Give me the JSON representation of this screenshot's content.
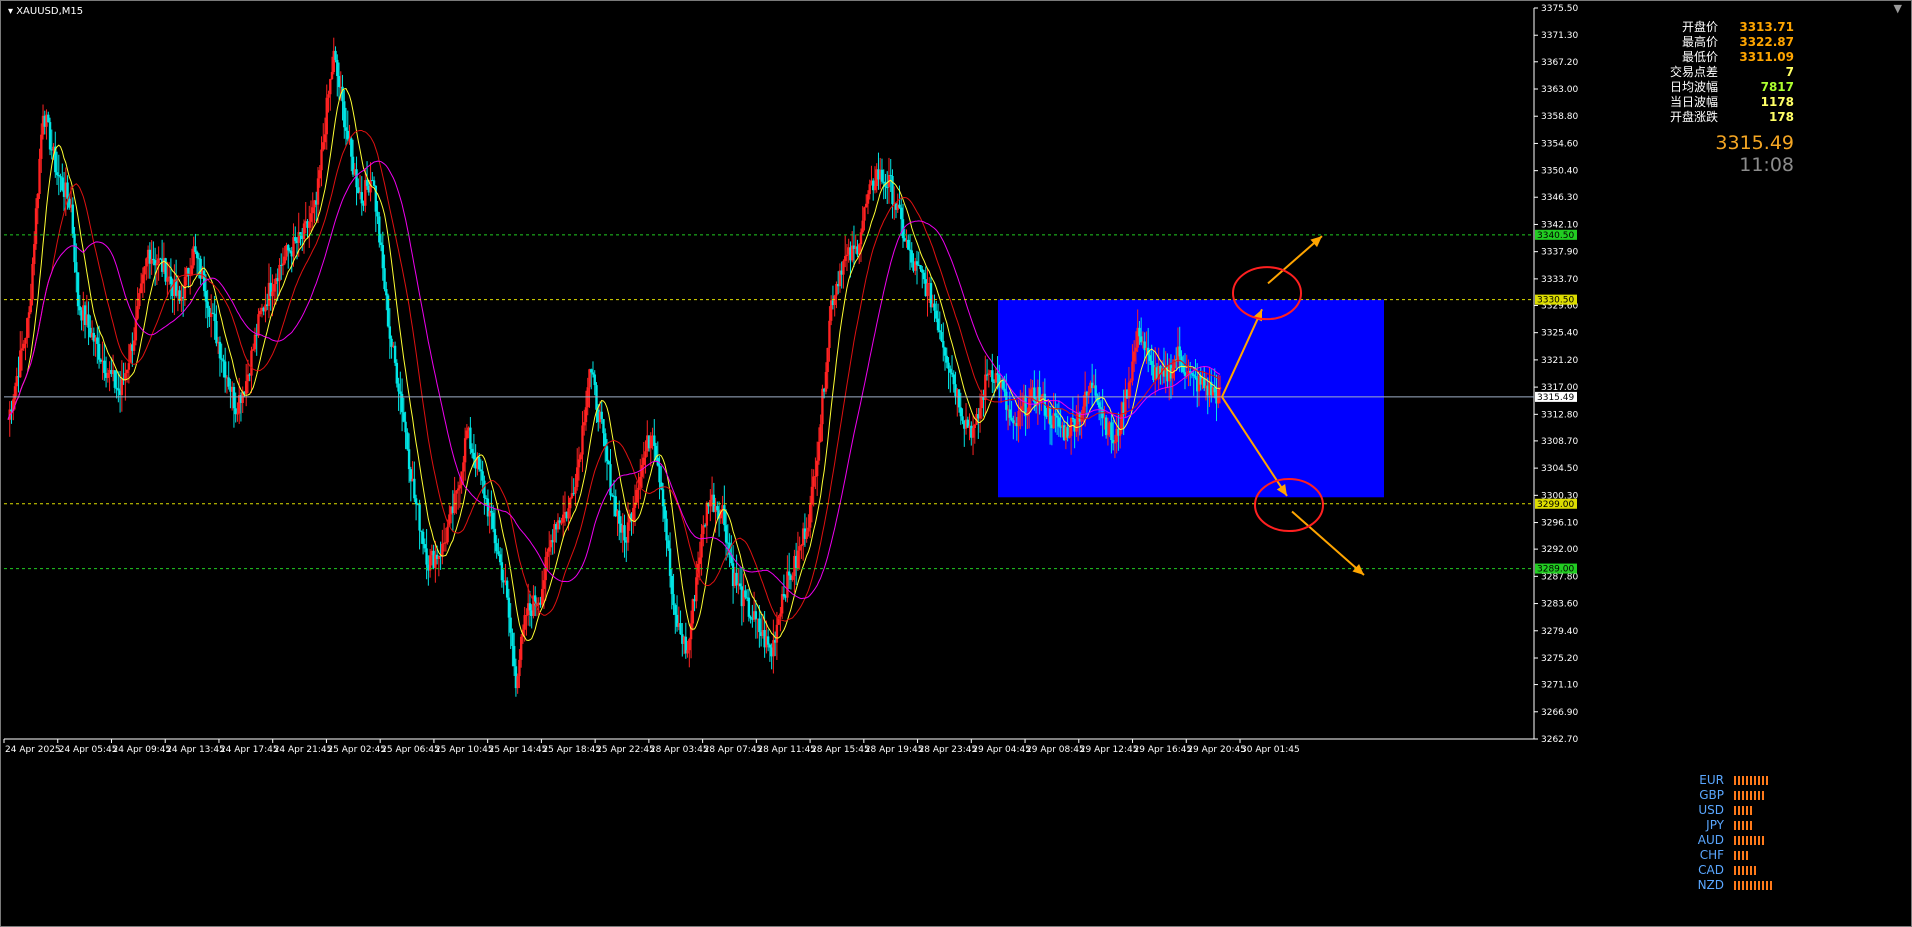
{
  "title": "XAUUSD,M15",
  "info_panel": [
    {
      "label": "开盘价",
      "value": "3313.71",
      "color": "#ffa500"
    },
    {
      "label": "最高价",
      "value": "3322.87",
      "color": "#ffa500"
    },
    {
      "label": "最低价",
      "value": "3311.09",
      "color": "#ffa500"
    },
    {
      "label": "交易点差",
      "value": "7",
      "color": "#ffff66"
    },
    {
      "label": "日均波幅",
      "value": "7817",
      "color": "#adff2f"
    },
    {
      "label": "当日波幅",
      "value": "1178",
      "color": "#ffff66"
    },
    {
      "label": "开盘涨跌",
      "value": "178",
      "color": "#ffff66"
    }
  ],
  "current_price": "3315.49",
  "countdown": "11:08",
  "currency_strength": [
    {
      "name": "EUR",
      "bars": 9
    },
    {
      "name": "GBP",
      "bars": 8
    },
    {
      "name": "USD",
      "bars": 5
    },
    {
      "name": "JPY",
      "bars": 5
    },
    {
      "name": "AUD",
      "bars": 8
    },
    {
      "name": "CHF",
      "bars": 4
    },
    {
      "name": "CAD",
      "bars": 6
    },
    {
      "name": "NZD",
      "bars": 10
    }
  ],
  "chart_data": {
    "type": "candlestick",
    "symbol": "XAUUSD",
    "timeframe": "M15",
    "ylim": [
      3262.7,
      3375.5
    ],
    "y_ticks": [
      "3375.50",
      "3371.30",
      "3367.20",
      "3363.00",
      "3358.80",
      "3354.60",
      "3350.40",
      "3346.30",
      "3342.10",
      "3337.90",
      "3333.70",
      "3329.60",
      "3325.40",
      "3321.20",
      "3317.00",
      "3312.80",
      "3308.70",
      "3304.50",
      "3300.30",
      "3296.10",
      "3292.00",
      "3287.80",
      "3283.60",
      "3279.40",
      "3275.20",
      "3271.10",
      "3266.90",
      "3262.70"
    ],
    "x_ticks": [
      "24 Apr 2025",
      "24 Apr 05:45",
      "24 Apr 09:45",
      "24 Apr 13:45",
      "24 Apr 17:45",
      "24 Apr 21:45",
      "25 Apr 02:45",
      "25 Apr 06:45",
      "25 Apr 10:45",
      "25 Apr 14:45",
      "25 Apr 18:45",
      "25 Apr 22:45",
      "28 Apr 03:45",
      "28 Apr 07:45",
      "28 Apr 11:45",
      "28 Apr 15:45",
      "28 Apr 19:45",
      "28 Apr 23:45",
      "29 Apr 04:45",
      "29 Apr 08:45",
      "29 Apr 12:45",
      "29 Apr 16:45",
      "29 Apr 20:45",
      "30 Apr 01:45"
    ],
    "current_price": 3315.49,
    "horizontal_levels": [
      {
        "value": 3340.5,
        "label": "3340.50",
        "color": "#22cc22"
      },
      {
        "value": 3330.5,
        "label": "3330.50",
        "color": "#dddd00"
      },
      {
        "value": 3299.0,
        "label": "3299.00",
        "color": "#dddd00"
      },
      {
        "value": 3289.0,
        "label": "3289.00",
        "color": "#22cc22"
      }
    ],
    "consolidation_box": {
      "price_high": 3330.5,
      "price_low": 3300.0,
      "color": "#0000ff"
    },
    "up_color": "#ff2222",
    "down_color": "#00e5e5",
    "close_path": [
      [
        0,
        3312
      ],
      [
        12,
        3328
      ],
      [
        20,
        3360
      ],
      [
        28,
        3350
      ],
      [
        36,
        3345
      ],
      [
        40,
        3330
      ],
      [
        48,
        3325
      ],
      [
        56,
        3320
      ],
      [
        64,
        3316
      ],
      [
        72,
        3325
      ],
      [
        80,
        3338
      ],
      [
        90,
        3335
      ],
      [
        98,
        3330
      ],
      [
        106,
        3338
      ],
      [
        112,
        3333
      ],
      [
        118,
        3326
      ],
      [
        124,
        3320
      ],
      [
        130,
        3314
      ],
      [
        136,
        3318
      ],
      [
        144,
        3328
      ],
      [
        152,
        3334
      ],
      [
        160,
        3338
      ],
      [
        168,
        3340
      ],
      [
        176,
        3345
      ],
      [
        182,
        3360
      ],
      [
        186,
        3368
      ],
      [
        190,
        3362
      ],
      [
        196,
        3352
      ],
      [
        202,
        3346
      ],
      [
        208,
        3350
      ],
      [
        212,
        3340
      ],
      [
        218,
        3325
      ],
      [
        224,
        3316
      ],
      [
        232,
        3300
      ],
      [
        240,
        3290
      ],
      [
        248,
        3292
      ],
      [
        256,
        3300
      ],
      [
        262,
        3310
      ],
      [
        270,
        3303
      ],
      [
        276,
        3296
      ],
      [
        284,
        3286
      ],
      [
        290,
        3272
      ],
      [
        296,
        3282
      ],
      [
        304,
        3285
      ],
      [
        312,
        3296
      ],
      [
        320,
        3298
      ],
      [
        326,
        3306
      ],
      [
        332,
        3320
      ],
      [
        338,
        3312
      ],
      [
        344,
        3302
      ],
      [
        352,
        3293
      ],
      [
        360,
        3303
      ],
      [
        368,
        3311
      ],
      [
        374,
        3300
      ],
      [
        380,
        3282
      ],
      [
        388,
        3276
      ],
      [
        394,
        3290
      ],
      [
        400,
        3300
      ],
      [
        408,
        3298
      ],
      [
        414,
        3288
      ],
      [
        420,
        3284
      ],
      [
        428,
        3280
      ],
      [
        436,
        3276
      ],
      [
        442,
        3285
      ],
      [
        450,
        3290
      ],
      [
        458,
        3298
      ],
      [
        464,
        3312
      ],
      [
        470,
        3330
      ],
      [
        476,
        3336
      ],
      [
        484,
        3338
      ],
      [
        490,
        3345
      ],
      [
        496,
        3350
      ],
      [
        504,
        3348
      ],
      [
        510,
        3342
      ],
      [
        516,
        3336
      ],
      [
        522,
        3334
      ],
      [
        528,
        3330
      ],
      [
        534,
        3324
      ],
      [
        540,
        3318
      ],
      [
        546,
        3312
      ],
      [
        552,
        3310
      ],
      [
        560,
        3320
      ],
      [
        566,
        3318
      ],
      [
        574,
        3310
      ],
      [
        580,
        3314
      ],
      [
        588,
        3316
      ],
      [
        596,
        3312
      ],
      [
        604,
        3310
      ],
      [
        612,
        3313
      ],
      [
        620,
        3318
      ],
      [
        626,
        3312
      ],
      [
        632,
        3308
      ],
      [
        640,
        3318
      ],
      [
        646,
        3326
      ],
      [
        652,
        3320
      ],
      [
        660,
        3318
      ],
      [
        668,
        3322
      ],
      [
        676,
        3318
      ],
      [
        684,
        3317
      ],
      [
        692,
        3315.5
      ]
    ],
    "annotations": [
      {
        "type": "arrow",
        "direction": "up",
        "color": "#ffa500"
      },
      {
        "type": "arrow",
        "direction": "down",
        "color": "#ffa500"
      },
      {
        "type": "circle",
        "color": "#ff2020"
      },
      {
        "type": "circle",
        "color": "#ff2020"
      }
    ]
  }
}
